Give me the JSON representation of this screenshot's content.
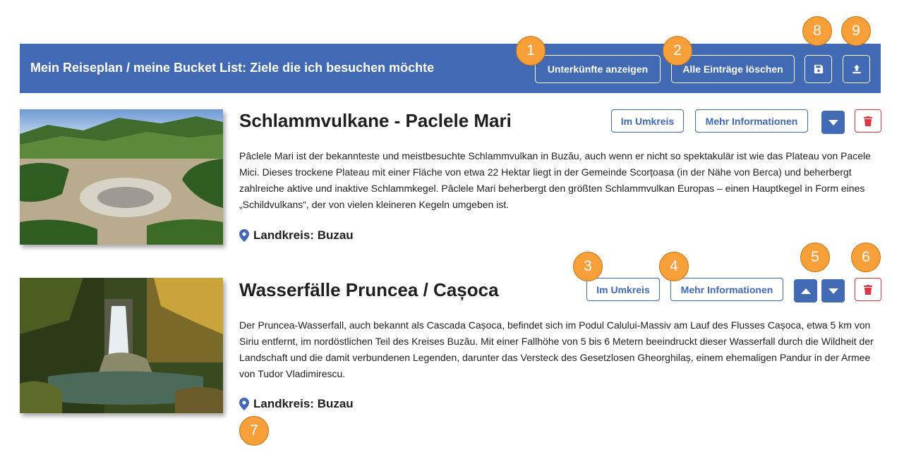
{
  "header": {
    "title": "Mein Reiseplan / meine Bucket List: Ziele die ich besuchen möchte",
    "show_accommodations_label": "Unterkünfte anzeigen",
    "delete_all_label": "Alle Einträge löschen",
    "save_icon": "save-icon",
    "export_icon": "upload-icon"
  },
  "entries": [
    {
      "title": "Schlammvulkane - Paclele Mari",
      "description": "Pâclele Mari ist der bekannteste und meistbesuchte Schlammvulkan in Buzău, auch wenn er nicht so spektakulär ist wie das Plateau von Pacele Mici. Dieses trockene Plateau mit einer Fläche von etwa 22 Hektar liegt in der Gemeinde Scorțoasa (in der Nähe von Berca) und beherbergt zahlreiche aktive und inaktive Schlammkegel. Pâclele Mari beherbergt den größten Schlammvulkan Europas – einen Hauptkegel in Form eines „Schildvulkans“, der von vielen kleineren Kegeln umgeben ist.",
      "region": "Landkreis: Buzau",
      "nearby_label": "Im Umkreis",
      "more_info_label": "Mehr Informationen"
    },
    {
      "title": "Wasserfälle Pruncea / Cașoca",
      "description": "Der Pruncea-Wasserfall, auch bekannt als Cascada Cașoca, befindet sich im Podul Calului-Massiv am Lauf des Flusses Cașoca, etwa 5 km von Siriu entfernt, im nordöstlichen Teil des Kreises Buzău. Mit einer Fallhöhe von 5 bis 6 Metern beeindruckt dieser Wasserfall durch die Wildheit der Landschaft und die damit verbundenen Legenden, darunter das Versteck des Gesetzlosen Gheorghilaș, einem ehemaligen Pandur in der Armee von Tudor Vladimirescu.",
      "region": "Landkreis: Buzau",
      "nearby_label": "Im Umkreis",
      "more_info_label": "Mehr Informationen"
    }
  ],
  "markers": [
    "1",
    "2",
    "3",
    "4",
    "5",
    "6",
    "7",
    "8",
    "9"
  ],
  "colors": {
    "primary": "#4169b4",
    "danger": "#dc3545",
    "marker": "#f7a03a"
  }
}
